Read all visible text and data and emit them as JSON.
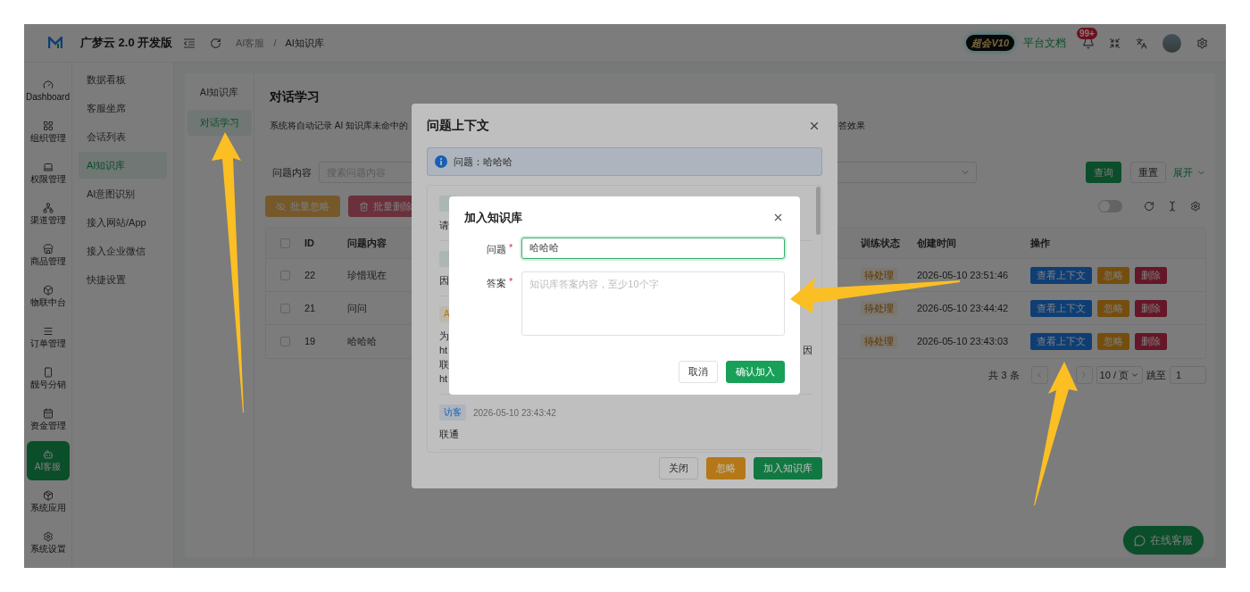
{
  "header": {
    "logo_text": "广梦云 2.0 开发版",
    "breadcrumb": [
      "AI客服",
      "AI知识库"
    ],
    "breadcrumb_separator": "/",
    "vip_badge": "超会V10",
    "docs_link": "平台文档",
    "notification_count": "99+"
  },
  "nav_rail": [
    {
      "label": "Dashboard",
      "selected": false
    },
    {
      "label": "组织管理",
      "selected": false
    },
    {
      "label": "权限管理",
      "selected": false
    },
    {
      "label": "渠道管理",
      "selected": false
    },
    {
      "label": "商品管理",
      "selected": false
    },
    {
      "label": "物联中台",
      "selected": false
    },
    {
      "label": "订单管理",
      "selected": false
    },
    {
      "label": "靓号分销",
      "selected": false
    },
    {
      "label": "资金管理",
      "selected": false
    },
    {
      "label": "AI客服",
      "selected": true
    },
    {
      "label": "系统应用",
      "selected": false
    },
    {
      "label": "系统设置",
      "selected": false
    }
  ],
  "submenu": [
    {
      "label": "数据看板",
      "selected": false
    },
    {
      "label": "客服坐席",
      "selected": false
    },
    {
      "label": "会话列表",
      "selected": false
    },
    {
      "label": "AI知识库",
      "selected": true
    },
    {
      "label": "AI意图识别",
      "selected": false
    },
    {
      "label": "接入网站/App",
      "selected": false
    },
    {
      "label": "接入企业微信",
      "selected": false
    },
    {
      "label": "快捷设置",
      "selected": false
    }
  ],
  "tabs": [
    {
      "label": "AI知识库",
      "selected": false
    },
    {
      "label": "对话学习",
      "selected": true
    }
  ],
  "page": {
    "title": "对话学习",
    "description_start": "系统将自动记录 AI 知识库未命中的",
    "description_end": "答效果"
  },
  "filters": {
    "label": "问题内容",
    "placeholder": "搜索问题内容",
    "query": "查询",
    "reset": "重置",
    "expand": "展开"
  },
  "batch_actions": [
    {
      "label": "批量忽略",
      "kind": "warning",
      "disabled": true
    },
    {
      "label": "批量删除",
      "kind": "error",
      "disabled": true
    }
  ],
  "table_toolbar": {
    "toggle_on": false
  },
  "table": {
    "all_checked": false,
    "columns_left": [
      "ID",
      "问题内容"
    ],
    "columns_right": [
      "训练状态",
      "创建时间",
      "操作"
    ],
    "rows": [
      {
        "id": "22",
        "question": "珍惜现在",
        "status": "待处理",
        "created": "2026-05-10 23:51:46",
        "checked": false,
        "actions": [
          {
            "label": "查看上下文",
            "kind": "info"
          },
          {
            "label": "忽略",
            "kind": "warning"
          },
          {
            "label": "删除",
            "kind": "error"
          }
        ]
      },
      {
        "id": "21",
        "question": "问问",
        "status": "待处理",
        "created": "2026-05-10 23:44:42",
        "checked": false,
        "actions": [
          {
            "label": "查看上下文",
            "kind": "info"
          },
          {
            "label": "忽略",
            "kind": "warning"
          },
          {
            "label": "删除",
            "kind": "error"
          }
        ]
      },
      {
        "id": "19",
        "question": "哈哈哈",
        "status": "待处理",
        "created": "2026-05-10 23:43:03",
        "checked": false,
        "actions": [
          {
            "label": "查看上下文",
            "kind": "info"
          },
          {
            "label": "忽略",
            "kind": "warning"
          },
          {
            "label": "删除",
            "kind": "error"
          }
        ]
      }
    ]
  },
  "pagination": {
    "total": "共 3 条",
    "page_size": "10 / 页",
    "jump_label": "跳至",
    "jump_value": "1"
  },
  "chat_button": "在线客服",
  "context_dialog": {
    "title": "问题上下文",
    "question": "问题：哈哈哈",
    "messages": [
      {
        "kind": "staff",
        "lines": [
          {
            "start": "请"
          }
        ]
      },
      {
        "kind": "staff",
        "lines": [
          {
            "start": "因"
          }
        ]
      },
      {
        "kind": "ai",
        "tag": "A",
        "lines": [
          {
            "start": "为"
          },
          {
            "start": "ht",
            "end": "因"
          },
          {
            "start": "联"
          },
          {
            "start": "ht"
          }
        ]
      },
      {
        "kind": "visitor",
        "tag": "访客",
        "time": "2026-05-10 23:43:42",
        "lines": [
          {
            "start": "联通"
          }
        ]
      }
    ],
    "buttons": [
      {
        "label": "关闭",
        "kind": "default"
      },
      {
        "label": "忽略",
        "kind": "warning"
      },
      {
        "label": "加入知识库",
        "kind": "primary"
      }
    ]
  },
  "add_dialog": {
    "title": "加入知识库",
    "fields": [
      {
        "kind": "input",
        "label": "问题",
        "required_mark": "*",
        "value": "哈哈哈",
        "focused": true
      },
      {
        "kind": "textarea",
        "label": "答案",
        "required_mark": "*",
        "placeholder": "知识库答案内容，至少10个字",
        "focused": false
      }
    ],
    "buttons": [
      {
        "label": "取消",
        "kind": "default"
      },
      {
        "label": "确认加入",
        "kind": "primary"
      }
    ]
  }
}
